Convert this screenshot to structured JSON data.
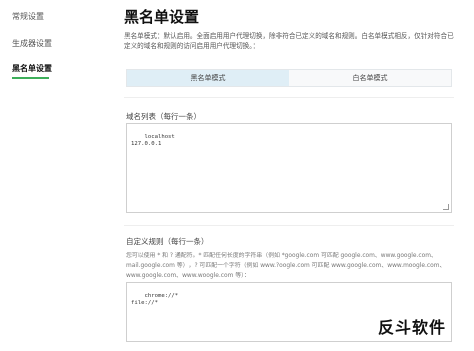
{
  "sidebar": {
    "items": [
      {
        "label": "常规设置"
      },
      {
        "label": "生成器设置"
      },
      {
        "label": "黑名单设置"
      }
    ]
  },
  "page": {
    "title": "黑名单设置",
    "description": "黑名单模式：默认启用。全面启用用户代理切换，除非符合已定义的域名和规则。白名单模式相反，仅针对符合已定义的域名和规则的访问启用用户代理切换。："
  },
  "tabs": [
    {
      "label": "黑名单模式",
      "active": true
    },
    {
      "label": "白名单模式",
      "active": false
    }
  ],
  "domain_list": {
    "label": "域名列表（每行一条）",
    "value": "localhost\n127.0.0.1"
  },
  "custom_rules": {
    "label": "自定义规则（每行一条）",
    "hint": "您可以使用 * 和 ? 通配符。* 匹配任何长度的字符串（例如 *google.com 可匹配 google.com、www.google.com、mail.google.com 等），? 可匹配一个字符（例如 www.?oogle.com 可匹配 www.google.com、www.moogle.com、www.google.com、www.woogle.com 等）：",
    "value": "chrome://*\nfile://*"
  },
  "watermark": "反斗软件",
  "colors": {
    "accent": "#3dae5a",
    "active_tab": "#dfeef6"
  }
}
